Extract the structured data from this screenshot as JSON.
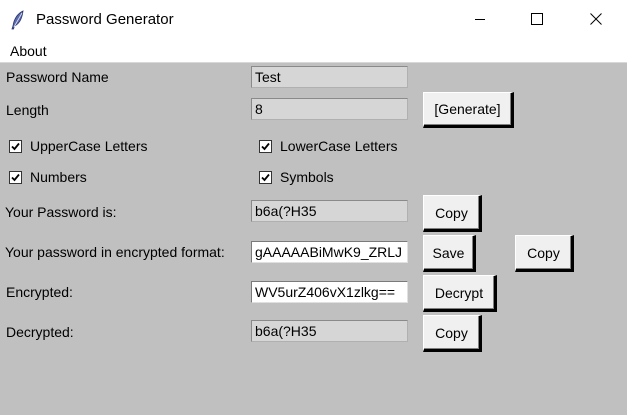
{
  "window": {
    "title": "Password Generator",
    "icon": "feather-icon",
    "controls": [
      "minimize-icon",
      "maximize-icon",
      "close-icon"
    ]
  },
  "menu": {
    "about": "About"
  },
  "form": {
    "password_name_label": "Password Name",
    "password_name_value": "Test",
    "length_label": "Length",
    "length_value": "8",
    "generate_label": "[Generate]",
    "uppercase_label": "UpperCase Letters",
    "lowercase_label": "LowerCase Letters",
    "numbers_label": "Numbers",
    "symbols_label": "Symbols",
    "uppercase_checked": true,
    "lowercase_checked": true,
    "numbers_checked": true,
    "symbols_checked": true,
    "your_password_label": "Your Password is:",
    "your_password_value": "b6a(?H35",
    "copy_label": "Copy",
    "encrypted_format_label": "Your password in encrypted format:",
    "encrypted_format_value": "gAAAAABiMwK9_ZRLJ",
    "save_label": "Save",
    "encrypted_label": "Encrypted:",
    "encrypted_value": "WV5urZ406vX1zlkg==",
    "decrypt_label": "Decrypt",
    "decrypted_label": "Decrypted:",
    "decrypted_value": "b6a(?H35"
  }
}
